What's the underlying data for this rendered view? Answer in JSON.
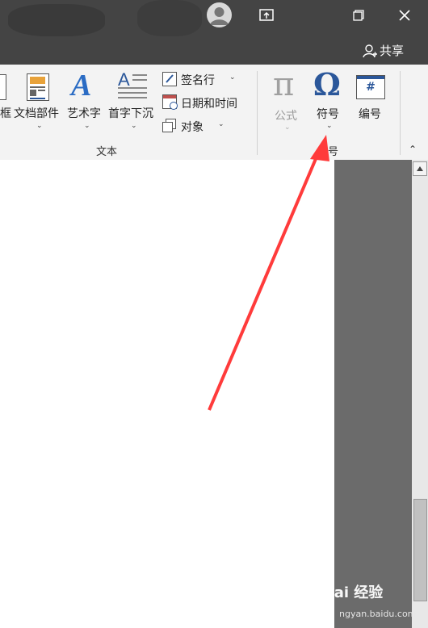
{
  "ribbon": {
    "items": [
      {
        "label": "框"
      },
      {
        "label": "文档部件"
      },
      {
        "label": "艺术字"
      },
      {
        "label": "首字下沉"
      }
    ],
    "small_items": [
      {
        "label": "签名行"
      },
      {
        "label": "日期和时间"
      },
      {
        "label": "对象"
      }
    ],
    "group_text_label": "文本",
    "formula_label": "公式",
    "symbol_label": "符号",
    "number_label": "编号",
    "group_symbols_label": "号"
  },
  "titlebar": {
    "share_label": "共享"
  },
  "watermark": {
    "brand": "Bai 经验",
    "url": "jingyan.baidu.com",
    "visible_url": "ngyan.baidu.com"
  },
  "icons": [
    "user-avatar-icon",
    "ribbon-display-icon",
    "restore-icon",
    "close-icon",
    "share-person-icon"
  ],
  "colors": {
    "accent": "#2b579a",
    "title_bg": "#444444",
    "ribbon_bg": "#f3f3f3",
    "arrow": "#ff3b3b"
  }
}
